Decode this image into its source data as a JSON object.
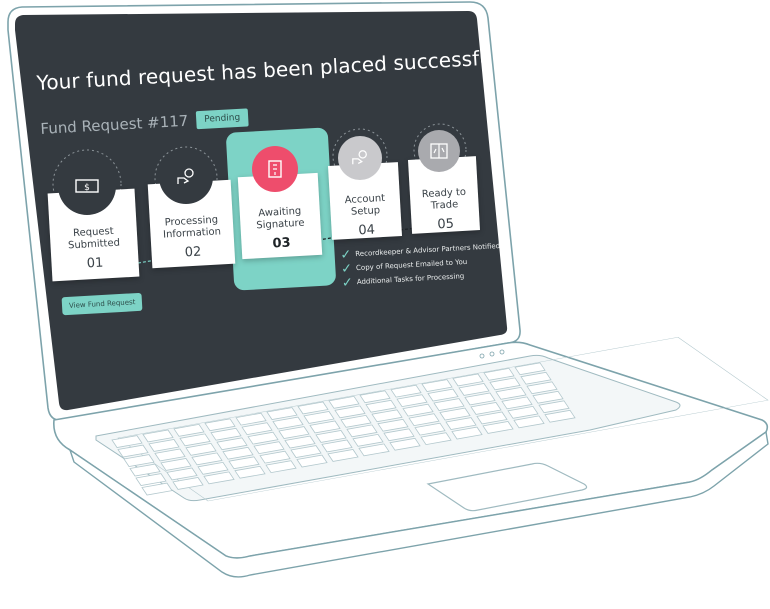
{
  "headline": "Your fund request has been placed successfully!",
  "request": {
    "number": "Fund Request #117",
    "status": "Pending"
  },
  "steps": [
    {
      "label1": "Request",
      "label2": "Submitted",
      "num": "01",
      "icon": "cash-icon"
    },
    {
      "label1": "Processing",
      "label2": "Information",
      "num": "02",
      "icon": "hand-coin-icon"
    },
    {
      "label1": "Awaiting",
      "label2": "Signature",
      "num": "03",
      "icon": "document-signature-icon"
    },
    {
      "label1": "Account",
      "label2": "Setup",
      "num": "04",
      "icon": "hand-coin-icon"
    },
    {
      "label1": "Ready to",
      "label2": "Trade",
      "num": "05",
      "icon": "trade-chart-icon"
    }
  ],
  "checklist": [
    "Recordkeeper & Advisor Partners Notified",
    "Copy of Request Emailed to You",
    "Additional Tasks for Processing"
  ],
  "view_button": "View Fund Request",
  "colors": {
    "screen": "#343a40",
    "accent": "#7dd3c6",
    "active_icon": "#ee4d6c",
    "inactive_icon": "#c9c9cc"
  }
}
